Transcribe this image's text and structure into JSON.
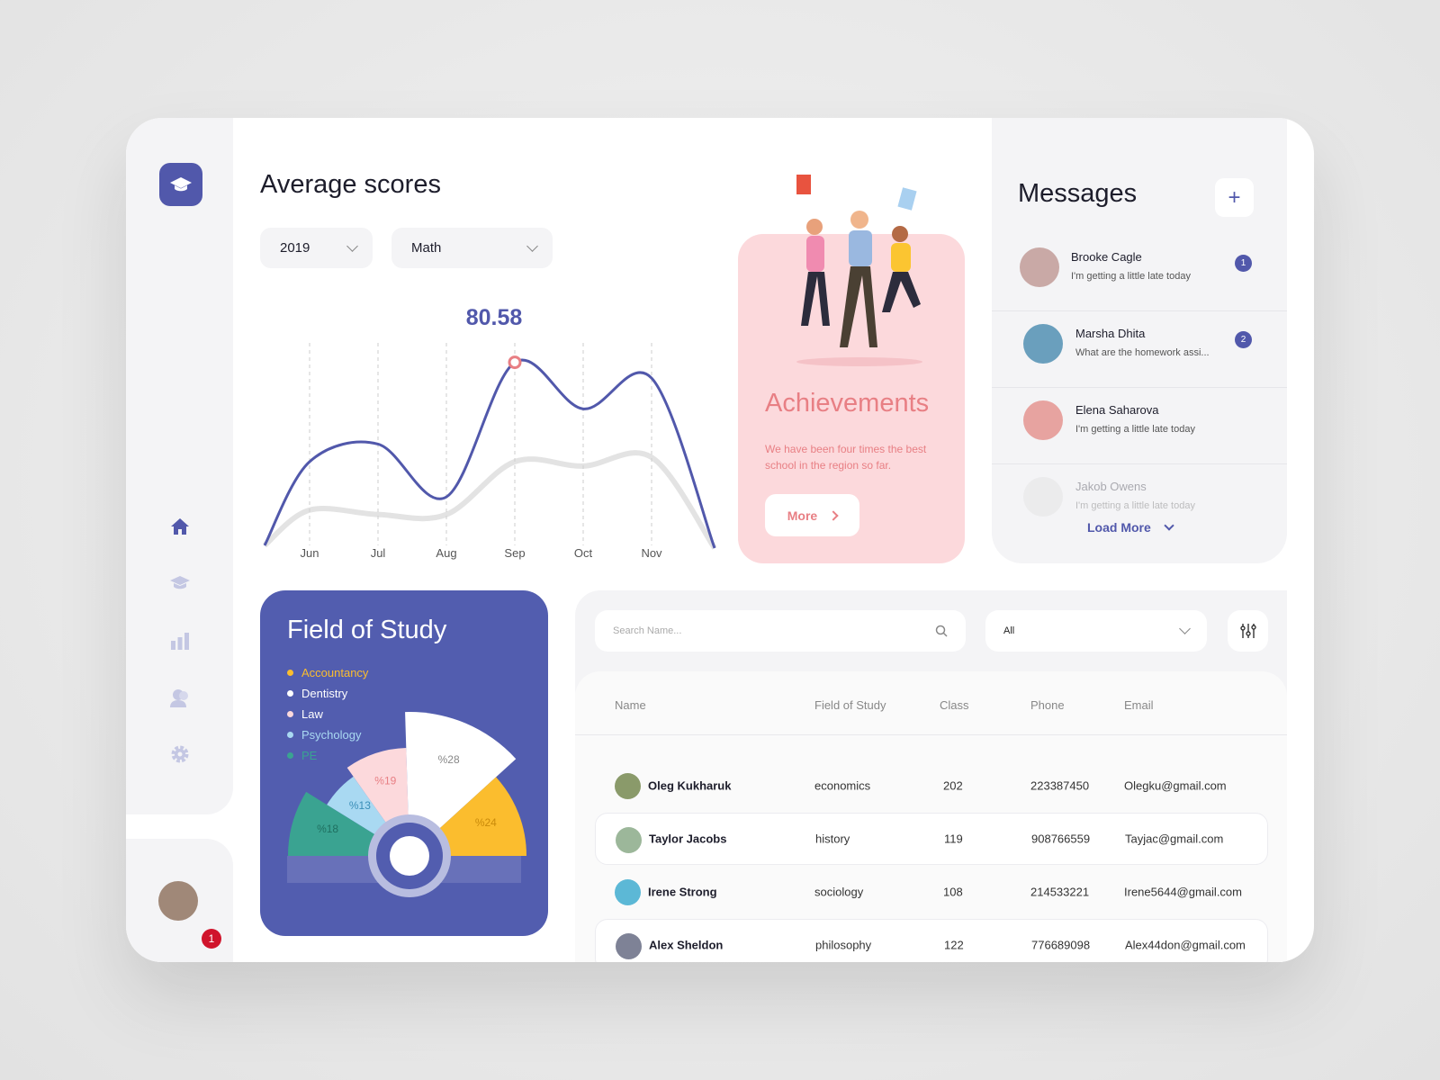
{
  "sidebar": {
    "nav_icons": [
      "home-icon",
      "graduation-cap-icon",
      "bar-chart-icon",
      "users-icon",
      "gear-icon"
    ],
    "notification_count": "1"
  },
  "scores": {
    "title": "Average scores",
    "year": "2019",
    "subject": "Math",
    "peak_label": "80.58"
  },
  "chart_data": {
    "type": "line",
    "categories": [
      "Jun",
      "Jul",
      "Aug",
      "Sep",
      "Oct",
      "Nov"
    ],
    "series": [
      {
        "values": [
          58,
          62,
          50,
          80.58,
          70,
          77
        ],
        "color": "#5158ab"
      },
      {
        "values": [
          47,
          46,
          46,
          58,
          57,
          59
        ],
        "color": "#d0d0d0"
      }
    ],
    "highlight": {
      "category": "Sep",
      "value": 80.58
    },
    "grid": "vertical-dashed",
    "ylim": [
      40,
      85
    ]
  },
  "achievements": {
    "title": "Achievements",
    "text": "We have been four times the best school in the region so far.",
    "button": "More"
  },
  "messages": {
    "title": "Messages",
    "add_label": "+",
    "load_more": "Load More",
    "items": [
      {
        "name": "Brooke Cagle",
        "text": "I'm getting a little late today",
        "badge": "1",
        "color": "#c9a9a6"
      },
      {
        "name": "Marsha Dhita",
        "text": "What are the homework assi...",
        "badge": "2",
        "color": "#6a9fbd"
      },
      {
        "name": "Elena Saharova",
        "text": "I'm getting a little late today",
        "badge": "",
        "color": "#e7a3a0"
      },
      {
        "name": "Jakob Owens",
        "text": "I'm getting a little late today",
        "badge": "",
        "color": "#dcdcdc"
      }
    ]
  },
  "field_of_study": {
    "title": "Field of Study",
    "items": [
      {
        "label": "Accountancy",
        "pct": 24,
        "display": "%24",
        "color": "#fbbd2e"
      },
      {
        "label": "Dentistry",
        "pct": 28,
        "display": "%28",
        "color": "#ffffff"
      },
      {
        "label": "Law",
        "pct": 19,
        "display": "%19",
        "color": "#fcd9dc"
      },
      {
        "label": "Psychology",
        "pct": 13,
        "display": "%13",
        "color": "#a9d9f2"
      },
      {
        "label": "PE",
        "pct": 18,
        "display": "%18",
        "color": "#3aa391"
      }
    ]
  },
  "students": {
    "search_placeholder": "Search Name...",
    "filter": "All",
    "headers": [
      "Name",
      "Field of Study",
      "Class",
      "Phone",
      "Email"
    ],
    "rows": [
      {
        "name": "Oleg Kukharuk",
        "field": "economics",
        "class": "202",
        "phone": "223387450",
        "email": "Olegku@gmail.com",
        "color": "#8a9a6a"
      },
      {
        "name": "Taylor Jacobs",
        "field": "history",
        "class": "119",
        "phone": "908766559",
        "email": "Tayjac@gmail.com",
        "color": "#9cb79a"
      },
      {
        "name": "Irene Strong",
        "field": "sociology",
        "class": "108",
        "phone": "214533221",
        "email": "Irene5644@gmail.com",
        "color": "#5cb8d6"
      },
      {
        "name": "Alex Sheldon",
        "field": "philosophy",
        "class": "122",
        "phone": "776689098",
        "email": "Alex44don@gmail.com",
        "color": "#7e8296"
      }
    ]
  }
}
